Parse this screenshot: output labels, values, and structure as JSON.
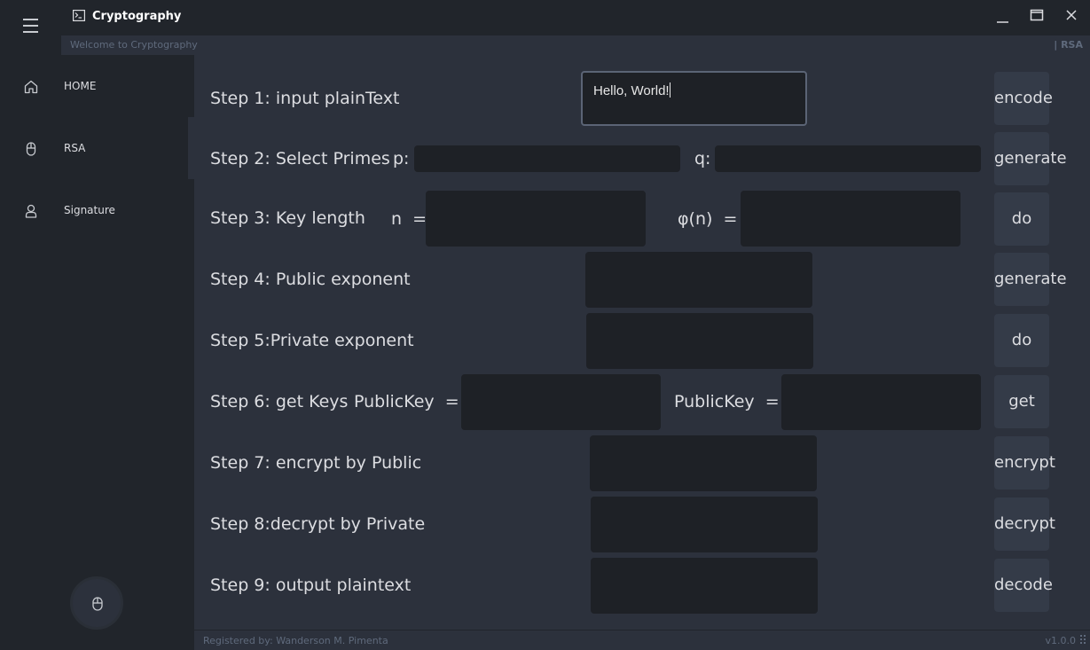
{
  "app": {
    "title": "Cryptography",
    "welcome": "Welcome to Cryptography",
    "page_indicator": "| RSA"
  },
  "sidebar": {
    "items": [
      {
        "label": "HOME",
        "icon": "home-icon"
      },
      {
        "label": "RSA",
        "icon": "mouse-icon"
      },
      {
        "label": "Signature",
        "icon": "user-icon"
      }
    ],
    "active": "RSA",
    "bottom_icon": "mouse-icon"
  },
  "steps": {
    "s1": {
      "label": "Step 1: input plainText",
      "value": "Hello, World!",
      "button": "encode"
    },
    "s2": {
      "label": "Step 2: Select Primes",
      "p_label": "p:",
      "q_label": "q:",
      "button": "generate"
    },
    "s3": {
      "label": "Step 3: Key length",
      "n_label": "n  =",
      "phi_label": "φ(n)  =",
      "button": "do"
    },
    "s4": {
      "label": "Step 4: Public exponent",
      "button": "generate"
    },
    "s5": {
      "label": "Step 5:Private exponent",
      "button": "do"
    },
    "s6": {
      "label": "Step 6: get Keys",
      "key1_label": "PublicKey  =",
      "key2_label": "PublicKey  =",
      "button": "get"
    },
    "s7": {
      "label": "Step 7: encrypt by Public",
      "button": "encrypt"
    },
    "s8": {
      "label": "Step 8:decrypt by Private",
      "button": "decrypt"
    },
    "s9": {
      "label": "Step 9: output plaintext",
      "button": "decode"
    }
  },
  "footer": {
    "credits": "Registered by: Wanderson M. Pimenta",
    "version": "v1.0.0"
  },
  "colors": {
    "background": "#21252b",
    "content": "#2c313c",
    "field": "#1e2126",
    "button": "#343b48",
    "muted_text": "#5f6a7c"
  }
}
